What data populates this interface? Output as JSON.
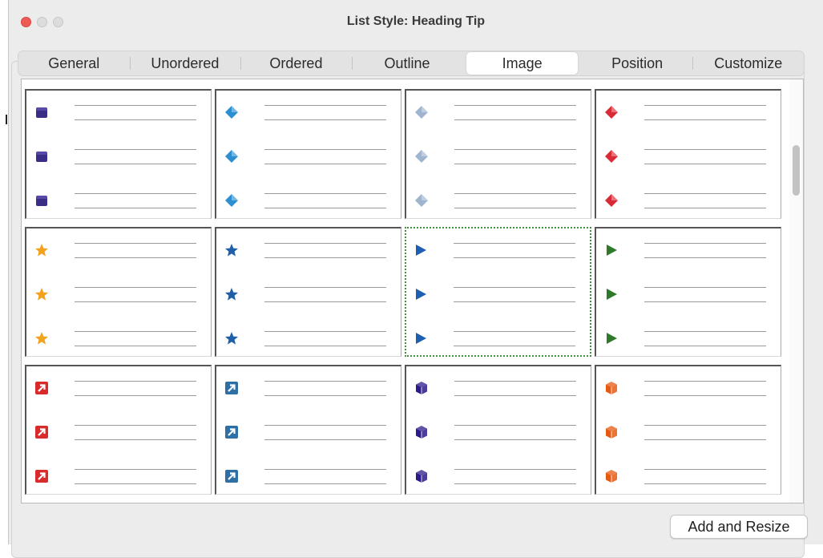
{
  "window": {
    "title": "List Style: Heading Tip"
  },
  "tabs": [
    {
      "label": "General"
    },
    {
      "label": "Unordered"
    },
    {
      "label": "Ordered"
    },
    {
      "label": "Outline"
    },
    {
      "label": "Image",
      "active": true
    },
    {
      "label": "Position"
    },
    {
      "label": "Customize"
    }
  ],
  "gallery": {
    "selected_index": 6,
    "items": [
      {
        "icon": "square-purple-icon",
        "color": "#3a2d86"
      },
      {
        "icon": "diamond-blue-icon",
        "color": "#2b8fd1"
      },
      {
        "icon": "diamond-lightblue-icon",
        "color": "#9fb5cf"
      },
      {
        "icon": "diamond-red-icon",
        "color": "#d92b35"
      },
      {
        "icon": "star-orange-icon",
        "color": "#f2a21d"
      },
      {
        "icon": "star-blue-icon",
        "color": "#1f5fa8"
      },
      {
        "icon": "triangle-blue-icon",
        "color": "#1e5fb1"
      },
      {
        "icon": "triangle-green-icon",
        "color": "#2f7a2a"
      },
      {
        "icon": "arrow-box-red-icon",
        "color": "#d92b2b"
      },
      {
        "icon": "arrow-box-blue-icon",
        "color": "#2e6fa5"
      },
      {
        "icon": "cube-purple-icon",
        "color": "#2d1a8a"
      },
      {
        "icon": "cube-orange-icon",
        "color": "#e65a12"
      }
    ]
  },
  "buttons": {
    "add_and_resize": "Add and Resize"
  }
}
